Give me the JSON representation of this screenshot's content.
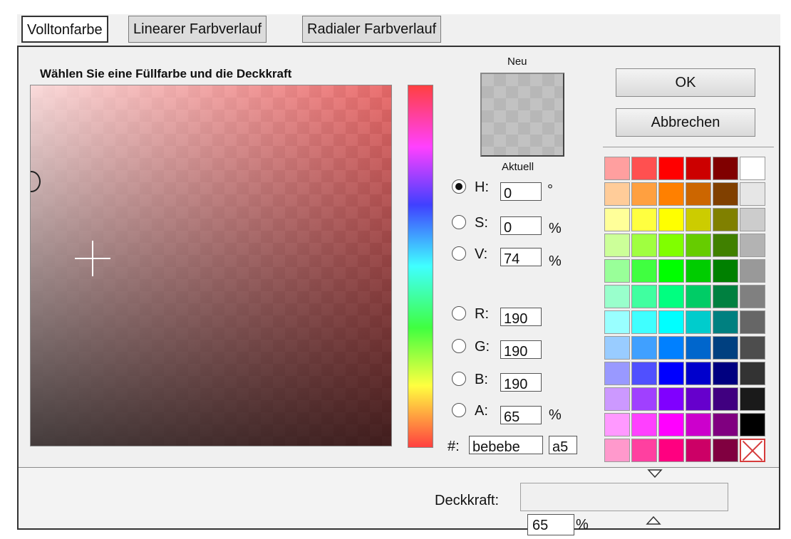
{
  "tabs": [
    {
      "label": "Volltonfarbe",
      "active": true
    },
    {
      "label": "Linearer Farbverlauf",
      "active": false
    },
    {
      "label": "Radialer Farbverlauf",
      "active": false
    }
  ],
  "picker": {
    "title": "Wählen Sie eine Füllfarbe und die Deckkraft",
    "hue_color": "#ff4040",
    "preview_new_label": "Neu",
    "preview_current_label": "Aktuell"
  },
  "fields": {
    "h": {
      "label": "H:",
      "value": "0",
      "unit": "°",
      "selected": true
    },
    "s": {
      "label": "S:",
      "value": "0",
      "unit": "%",
      "selected": false
    },
    "v": {
      "label": "V:",
      "value": "74",
      "unit": "%",
      "selected": false
    },
    "r": {
      "label": "R:",
      "value": "190",
      "selected": false
    },
    "g": {
      "label": "G:",
      "value": "190",
      "selected": false
    },
    "b": {
      "label": "B:",
      "value": "190",
      "selected": false
    },
    "a": {
      "label": "A:",
      "value": "65",
      "unit": "%",
      "selected": false
    },
    "hex": {
      "label": "#:",
      "value": "bebebe",
      "alpha": "a5"
    }
  },
  "buttons": {
    "ok": "OK",
    "cancel": "Abbrechen"
  },
  "palette": [
    [
      "#ff9f9f",
      "#ff5050",
      "#ff0000",
      "#cc0000",
      "#800000",
      "#ffffff"
    ],
    [
      "#ffcc99",
      "#ffa040",
      "#ff8000",
      "#cc6600",
      "#804000",
      "#e6e6e6"
    ],
    [
      "#ffff99",
      "#ffff40",
      "#ffff00",
      "#cccc00",
      "#808000",
      "#cccccc"
    ],
    [
      "#ccff99",
      "#a0ff40",
      "#80ff00",
      "#66cc00",
      "#408000",
      "#b3b3b3"
    ],
    [
      "#99ff99",
      "#40ff40",
      "#00ff00",
      "#00cc00",
      "#008000",
      "#999999"
    ],
    [
      "#99ffcc",
      "#40ffa0",
      "#00ff80",
      "#00cc66",
      "#008040",
      "#808080"
    ],
    [
      "#99ffff",
      "#40ffff",
      "#00ffff",
      "#00cccc",
      "#008080",
      "#666666"
    ],
    [
      "#99ccff",
      "#40a0ff",
      "#0080ff",
      "#0066cc",
      "#004080",
      "#4d4d4d"
    ],
    [
      "#9999ff",
      "#5050ff",
      "#0000ff",
      "#0000cc",
      "#000080",
      "#333333"
    ],
    [
      "#cc99ff",
      "#a040ff",
      "#8000ff",
      "#6600cc",
      "#400080",
      "#1a1a1a"
    ],
    [
      "#ff99ff",
      "#ff40ff",
      "#ff00ff",
      "#cc00cc",
      "#800080",
      "#000000"
    ],
    [
      "#ff99cc",
      "#ff40a0",
      "#ff0080",
      "#cc0066",
      "#800040",
      "none"
    ]
  ],
  "opacity": {
    "label": "Deckkraft:",
    "value": "65",
    "unit": "%"
  }
}
